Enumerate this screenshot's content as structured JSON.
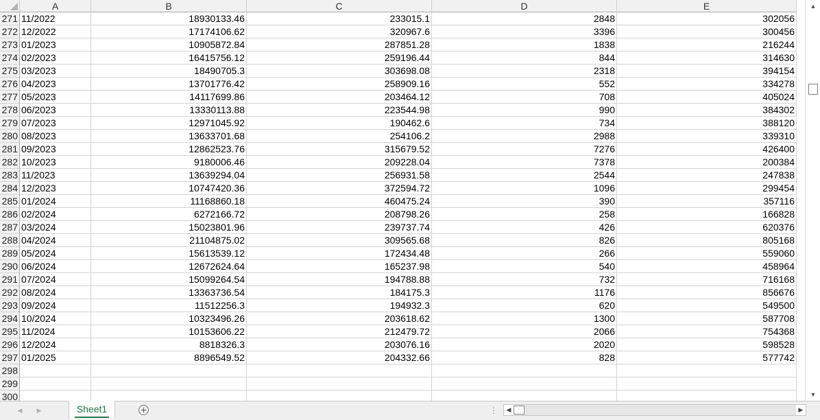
{
  "columns": [
    "A",
    "B",
    "C",
    "D",
    "E"
  ],
  "rows": [
    {
      "n": "271",
      "a": "11/2022",
      "b": "18930133.46",
      "c": "233015.1",
      "d": "2848",
      "e": "302056"
    },
    {
      "n": "272",
      "a": "12/2022",
      "b": "17174106.62",
      "c": "320967.6",
      "d": "3396",
      "e": "300456"
    },
    {
      "n": "273",
      "a": "01/2023",
      "b": "10905872.84",
      "c": "287851.28",
      "d": "1838",
      "e": "216244"
    },
    {
      "n": "274",
      "a": "02/2023",
      "b": "16415756.12",
      "c": "259196.44",
      "d": "844",
      "e": "314630"
    },
    {
      "n": "275",
      "a": "03/2023",
      "b": "18490705.3",
      "c": "303698.08",
      "d": "2318",
      "e": "394154"
    },
    {
      "n": "276",
      "a": "04/2023",
      "b": "13701776.42",
      "c": "258909.16",
      "d": "552",
      "e": "334278"
    },
    {
      "n": "277",
      "a": "05/2023",
      "b": "14117699.86",
      "c": "203464.12",
      "d": "708",
      "e": "405024"
    },
    {
      "n": "278",
      "a": "06/2023",
      "b": "13330113.88",
      "c": "223544.98",
      "d": "990",
      "e": "384302"
    },
    {
      "n": "279",
      "a": "07/2023",
      "b": "12971045.92",
      "c": "190462.6",
      "d": "734",
      "e": "388120"
    },
    {
      "n": "280",
      "a": "08/2023",
      "b": "13633701.68",
      "c": "254106.2",
      "d": "2988",
      "e": "339310"
    },
    {
      "n": "281",
      "a": "09/2023",
      "b": "12862523.76",
      "c": "315679.52",
      "d": "7276",
      "e": "426400"
    },
    {
      "n": "282",
      "a": "10/2023",
      "b": "9180006.46",
      "c": "209228.04",
      "d": "7378",
      "e": "200384"
    },
    {
      "n": "283",
      "a": "11/2023",
      "b": "13639294.04",
      "c": "256931.58",
      "d": "2544",
      "e": "247838"
    },
    {
      "n": "284",
      "a": "12/2023",
      "b": "10747420.36",
      "c": "372594.72",
      "d": "1096",
      "e": "299454"
    },
    {
      "n": "285",
      "a": "01/2024",
      "b": "11168860.18",
      "c": "460475.24",
      "d": "390",
      "e": "357116"
    },
    {
      "n": "286",
      "a": "02/2024",
      "b": "6272166.72",
      "c": "208798.26",
      "d": "258",
      "e": "166828"
    },
    {
      "n": "287",
      "a": "03/2024",
      "b": "15023801.96",
      "c": "239737.74",
      "d": "426",
      "e": "620376"
    },
    {
      "n": "288",
      "a": "04/2024",
      "b": "21104875.02",
      "c": "309565.68",
      "d": "826",
      "e": "805168"
    },
    {
      "n": "289",
      "a": "05/2024",
      "b": "15613539.12",
      "c": "172434.48",
      "d": "266",
      "e": "559060"
    },
    {
      "n": "290",
      "a": "06/2024",
      "b": "12672624.64",
      "c": "165237.98",
      "d": "540",
      "e": "458964"
    },
    {
      "n": "291",
      "a": "07/2024",
      "b": "15099264.54",
      "c": "194788.88",
      "d": "732",
      "e": "716168"
    },
    {
      "n": "292",
      "a": "08/2024",
      "b": "13363736.54",
      "c": "184175.3",
      "d": "1176",
      "e": "856676"
    },
    {
      "n": "293",
      "a": "09/2024",
      "b": "11512256.3",
      "c": "194932.3",
      "d": "620",
      "e": "549500"
    },
    {
      "n": "294",
      "a": "10/2024",
      "b": "10323496.26",
      "c": "203618.62",
      "d": "1300",
      "e": "587708"
    },
    {
      "n": "295",
      "a": "11/2024",
      "b": "10153606.22",
      "c": "212479.72",
      "d": "2066",
      "e": "754368"
    },
    {
      "n": "296",
      "a": "12/2024",
      "b": "8818326.3",
      "c": "203076.16",
      "d": "2020",
      "e": "598528"
    },
    {
      "n": "297",
      "a": "01/2025",
      "b": "8896549.52",
      "c": "204332.66",
      "d": "828",
      "e": "577742"
    },
    {
      "n": "298",
      "a": "",
      "b": "",
      "c": "",
      "d": "",
      "e": ""
    },
    {
      "n": "299",
      "a": "",
      "b": "",
      "c": "",
      "d": "",
      "e": ""
    },
    {
      "n": "300",
      "a": "",
      "b": "",
      "c": "",
      "d": "",
      "e": ""
    }
  ],
  "sheet_tab": "Sheet1",
  "icons": {
    "add_sheet": "+",
    "scroll_up": "▲",
    "scroll_down": "▼",
    "scroll_left": "◀",
    "scroll_right": "▶",
    "tab_prev": "◀",
    "tab_next": "▶",
    "splitter": "⋮"
  }
}
